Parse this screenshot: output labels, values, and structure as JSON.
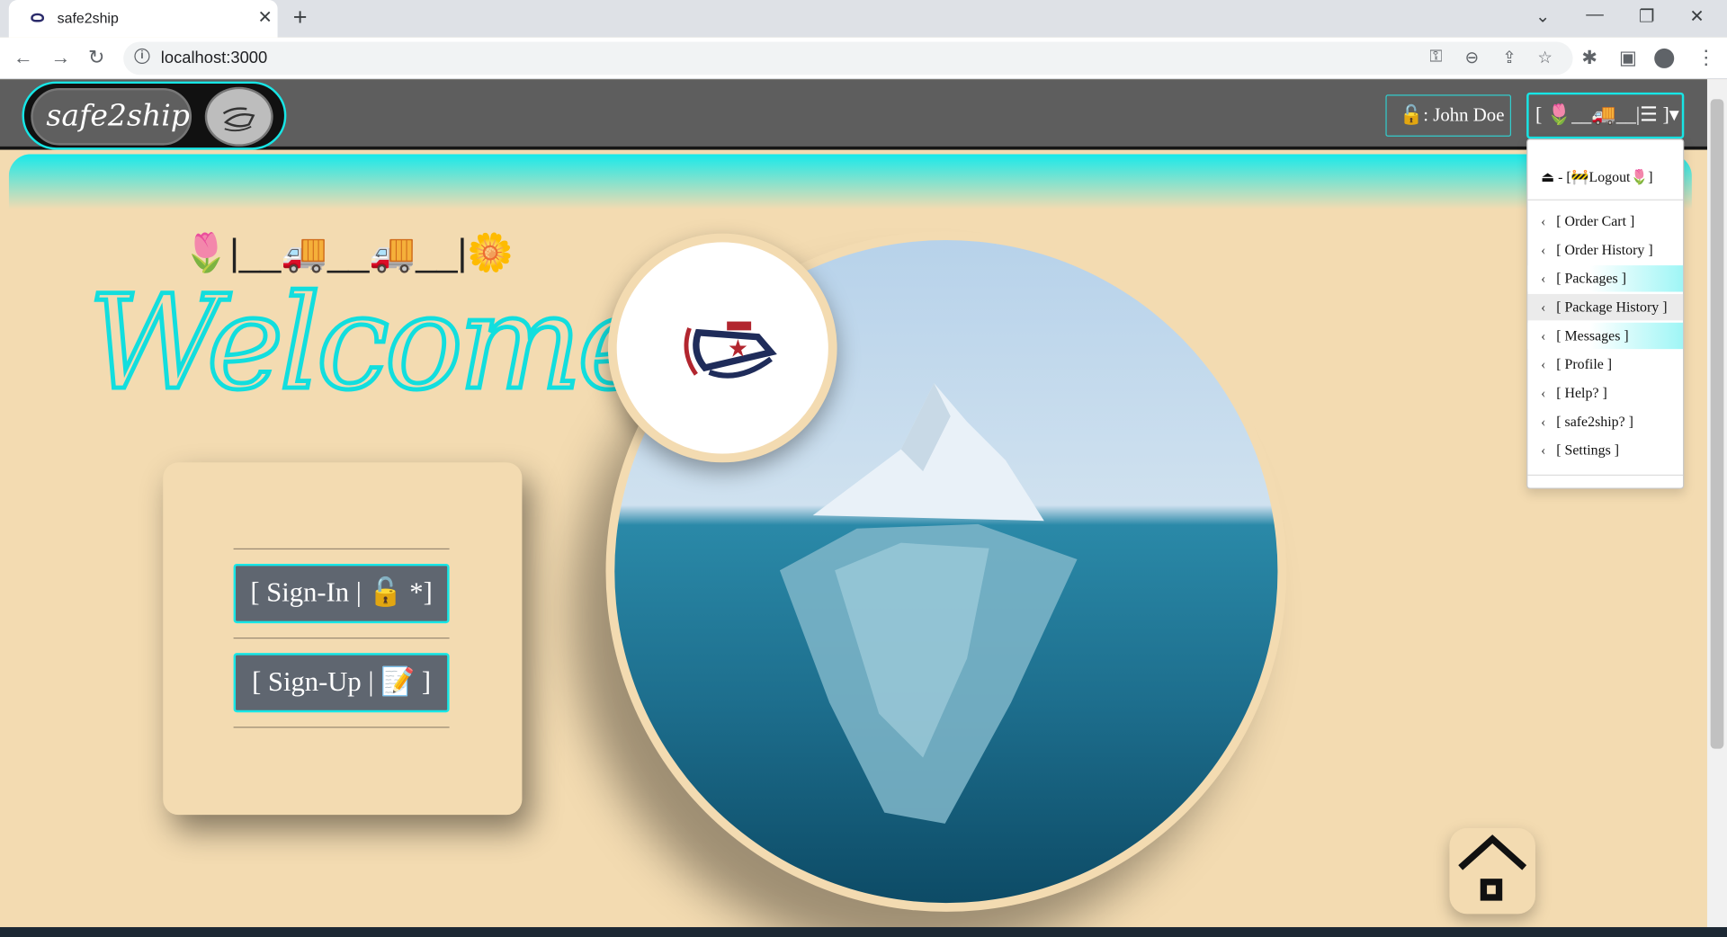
{
  "browser": {
    "tab_title": "safe2ship",
    "url": "localhost:3000"
  },
  "header": {
    "brand": "safe2ship",
    "user_label": "🔓: John Doe",
    "dropdown_label": "[ 🌷__🚚__|☰ ]▾"
  },
  "dropdown": {
    "logout": "⏏ - [🚧Logout🌷]",
    "items": [
      "[ Order Cart ]",
      "[ Order History ]",
      "[ Packages ]",
      "[ Package History ]",
      "[ Messages ]",
      "[ Profile ]",
      "[ Help? ]",
      "[ safe2ship? ]",
      "[ Settings ]"
    ]
  },
  "main": {
    "emoji_row": "🌷|__🚚__🚚__|🌼",
    "welcome": "Welcome!",
    "signin_label": "[ Sign-In | 🔓 *]",
    "signup_label": "[ Sign-Up | 📝 ]"
  },
  "colors": {
    "accent": "#17e6e6",
    "page_bg": "#f3dbb1",
    "header_bg": "#5e5e5e"
  }
}
